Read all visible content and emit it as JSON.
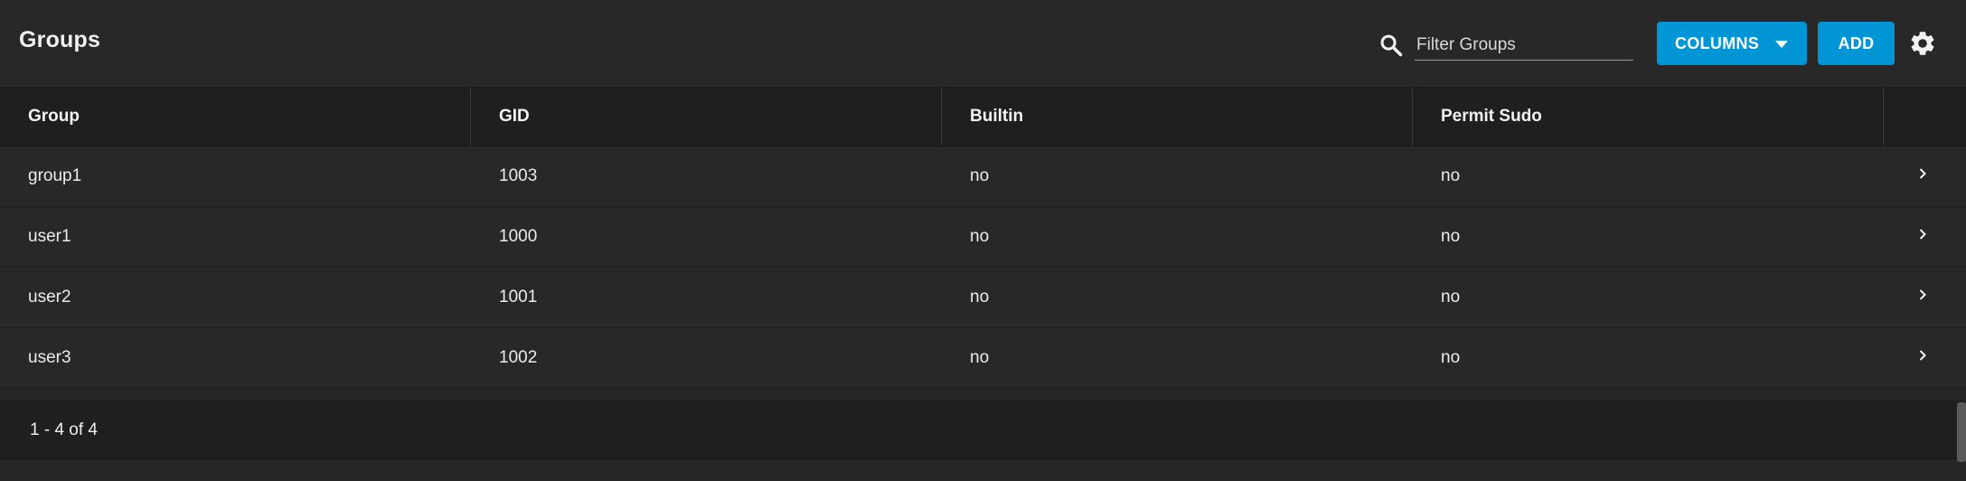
{
  "header": {
    "title": "Groups",
    "filter_placeholder": "Filter Groups",
    "filter_value": "",
    "columns_label": "COLUMNS",
    "add_label": "ADD"
  },
  "table": {
    "columns": [
      "Group",
      "GID",
      "Builtin",
      "Permit Sudo"
    ],
    "rows": [
      {
        "group": "group1",
        "gid": "1003",
        "builtin": "no",
        "sudo": "no"
      },
      {
        "group": "user1",
        "gid": "1000",
        "builtin": "no",
        "sudo": "no"
      },
      {
        "group": "user2",
        "gid": "1001",
        "builtin": "no",
        "sudo": "no"
      },
      {
        "group": "user3",
        "gid": "1002",
        "builtin": "no",
        "sudo": "no"
      }
    ]
  },
  "footer": {
    "range": "1 - 4 of 4"
  },
  "colors": {
    "accent": "#0095d5",
    "background": "#262626",
    "header_bg": "#1f1f1f"
  },
  "icons": {
    "search": "search-icon",
    "settings": "gear-icon",
    "expand": "chevron-right-icon",
    "dropdown": "caret-down-icon"
  }
}
